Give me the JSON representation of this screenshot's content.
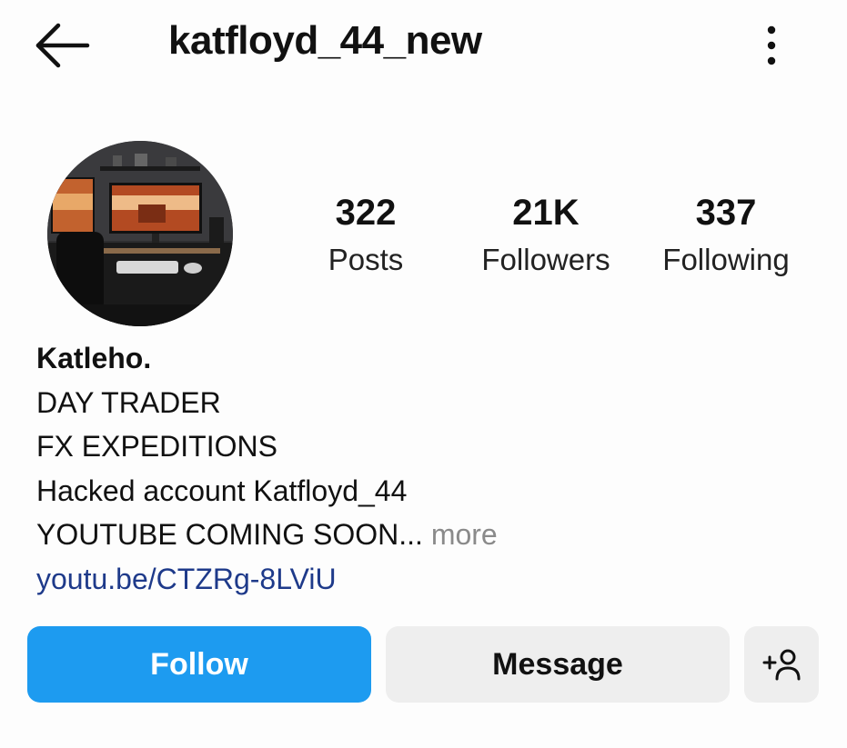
{
  "header": {
    "username": "katfloyd_44_new",
    "back_icon": "arrow-left-icon",
    "more_icon": "more-vertical-icon"
  },
  "profile": {
    "avatar_description": "desk-setup-photo",
    "stats": [
      {
        "value": "322",
        "label": "Posts"
      },
      {
        "value": "21K",
        "label": "Followers"
      },
      {
        "value": "337",
        "label": "Following"
      }
    ]
  },
  "bio": {
    "name": "Katleho.",
    "lines": [
      "DAY TRADER",
      "FX EXPEDITIONS",
      "Hacked account Katfloyd_44",
      "YOUTUBE COMING SOON"
    ],
    "ellipsis": "...",
    "more": " more",
    "link": "youtu.be/CTZRg-8LViU"
  },
  "actions": {
    "follow_label": "Follow",
    "message_label": "Message",
    "suggest_icon": "add-person-icon"
  },
  "colors": {
    "follow_button": "#1d9bf0",
    "secondary_button": "#eeeeee",
    "link": "#1e3a8a",
    "more_text": "#8a8a8a"
  }
}
